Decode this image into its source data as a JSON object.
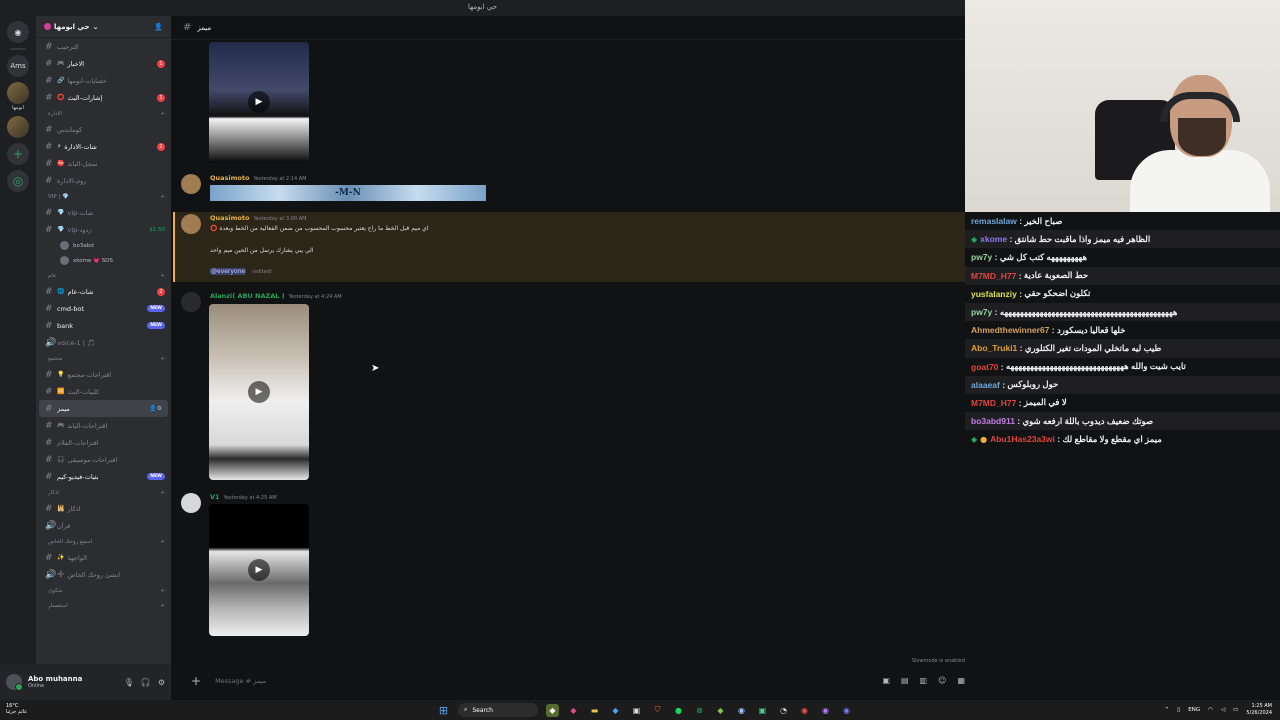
{
  "window": {
    "title": "حي ابومها"
  },
  "servers": [
    {
      "label": "Ams"
    },
    {
      "label": "ابومها"
    }
  ],
  "guild": {
    "name": "حي ابومها"
  },
  "channels": [
    {
      "type": "text",
      "emoji": "",
      "label": "الترحيب",
      "badge": ""
    },
    {
      "type": "text",
      "emoji": "🎮",
      "label": "الاخبار",
      "badge": "1"
    },
    {
      "type": "text",
      "emoji": "🔗",
      "label": "خصايات-ابومها",
      "badge": ""
    },
    {
      "type": "text",
      "emoji": "⭕",
      "label": "إشارات-البث",
      "badge": "1"
    },
    {
      "type": "cat",
      "label": "الادارة"
    },
    {
      "type": "text",
      "emoji": "",
      "label": "كوماندس",
      "badge": ""
    },
    {
      "type": "text",
      "emoji": "⚡",
      "label": "شات-الادارة",
      "badge": "2"
    },
    {
      "type": "text",
      "emoji": "⛔",
      "label": "سجل-الباند",
      "badge": ""
    },
    {
      "type": "text",
      "emoji": "",
      "label": "روم-الادارة",
      "badge": ""
    },
    {
      "type": "cat",
      "label": "VIP | 💎"
    },
    {
      "type": "text",
      "emoji": "💎",
      "label": "vip-شات",
      "badge": ""
    },
    {
      "type": "text",
      "emoji": "💎",
      "label": "vip-ردود",
      "price": "$1.50"
    },
    {
      "type": "voice-user",
      "label": "bo3abd"
    },
    {
      "type": "voice-user",
      "label": "xkome 💗 SOS"
    },
    {
      "type": "cat",
      "label": "عام"
    },
    {
      "type": "text",
      "emoji": "🌐",
      "label": "شات-عام",
      "badge": "2"
    },
    {
      "type": "text",
      "emoji": "",
      "label": "cmd-bot",
      "new": "NEW"
    },
    {
      "type": "text",
      "emoji": "",
      "label": "bank",
      "new": "NEW"
    },
    {
      "type": "voice",
      "emoji": "",
      "label": "voice-1 | 🎵"
    },
    {
      "type": "cat",
      "label": "مجتمع"
    },
    {
      "type": "text",
      "emoji": "💡",
      "label": "اقتراحات-مجتمع",
      "badge": ""
    },
    {
      "type": "text",
      "emoji": "🆚",
      "label": "كليبات-البث",
      "badge": ""
    },
    {
      "type": "text",
      "emoji": "",
      "label": "ميمز",
      "selected": true
    },
    {
      "type": "text",
      "emoji": "🎮",
      "label": "اقتراحات-الباند",
      "badge": ""
    },
    {
      "type": "text",
      "emoji": "",
      "label": "اقتراحات-الفلام",
      "badge": ""
    },
    {
      "type": "text",
      "emoji": "🎧",
      "label": "اقتراحات-موسيقى",
      "badge": ""
    },
    {
      "type": "text",
      "emoji": "",
      "label": "بثيات-فيديو-كيم",
      "new": "NEW"
    },
    {
      "type": "cat",
      "label": "اذكار"
    },
    {
      "type": "text",
      "emoji": "🕌",
      "label": "اذكار",
      "badge": ""
    },
    {
      "type": "voice",
      "emoji": "",
      "label": "قرآن"
    },
    {
      "type": "cat",
      "label": "اسمع روحك الخاص"
    },
    {
      "type": "text",
      "emoji": "✨",
      "label": "الواجهة",
      "badge": ""
    },
    {
      "type": "voice",
      "emoji": "➕",
      "label": "انشئ روحك الخاص"
    },
    {
      "type": "cat",
      "label": "شكوى"
    },
    {
      "type": "cat",
      "label": "استفسار"
    }
  ],
  "user": {
    "name": "Abo muhanna",
    "status": "Online"
  },
  "channel_header": {
    "name": "ميمز"
  },
  "messages": {
    "m1": {
      "author": "Quasimoto",
      "time": "Yesterday at 2:14 AM",
      "banner": "-M-N"
    },
    "m2": {
      "author": "Quasimoto",
      "time": "Yesterday at 3:00 AM",
      "line1": "اي ميم قبل الخط ما راح يعتبر محسوب المحسوب من ضمن الفعالية من الخط وبعده",
      "line2": "الي يبي يشارك يرسل من الحين ميم واحد",
      "mention": "@everyone",
      "edited": "(edited)"
    },
    "m3": {
      "author": "Alanzi( ABU NAZAL )",
      "time": "Yesterday at 4:24 AM"
    },
    "m4": {
      "author": "V1",
      "time": "Yesterday at 4:25 AM"
    }
  },
  "composer": {
    "placeholder": "Message # ميمز"
  },
  "slowmode": "Slowmode is enabled",
  "twitch_chat": [
    {
      "user": "remaslalaw",
      "color": "#6fa8dc",
      "text": "صباح الخير"
    },
    {
      "user": "xkome",
      "color": "#8a7bf0",
      "text": "الظاهر فيه ميمز واذا ماقبت حط شانتق",
      "badge": "green"
    },
    {
      "user": "pw7y",
      "color": "#9ad0a0",
      "text": "هههههههههه كتب كل شي"
    },
    {
      "user": "M7MD_H77",
      "color": "#e0443e",
      "text": "حط الصعوبة عادية"
    },
    {
      "user": "yusfalanziy",
      "color": "#e0e050",
      "text": "تكلون اضحكو حقي"
    },
    {
      "user": "pw7y",
      "color": "#9ad0a0",
      "text": "ههههههههههههههههههههههههههههههههههههههههههههه"
    },
    {
      "user": "Ahmedthewinner67",
      "color": "#d4a35a",
      "text": "خلها قعاليا ديسكورد"
    },
    {
      "user": "Abo_Truki1",
      "color": "#e0a030",
      "text": "طيب ليه ماتخلي المودات تغير الكتلوري"
    },
    {
      "user": "goat70",
      "color": "#e0443e",
      "text": "تايب شيت والله ههههههههههههههههههههههههههههههه"
    },
    {
      "user": "alaaeaf",
      "color": "#6fa8dc",
      "text": "حول روبلوكس"
    },
    {
      "user": "M7MD_H77",
      "color": "#e0443e",
      "text": "لا في الميمز"
    },
    {
      "user": "bo3abd911",
      "color": "#c080e0",
      "text": "صوتك ضعيف ديدوب باللهَ ارفعه شوي"
    },
    {
      "user": "Abu1Has23a3wi",
      "color": "#e0443e",
      "text": "ميمز اي مقطع ولا مقاطع لك",
      "badge": "both"
    }
  ],
  "taskbar": {
    "weather_temp": "16°C",
    "weather_desc": "غائم جزئيا",
    "search": "Search",
    "lang": "ENG",
    "time": "1:25 AM",
    "date": "5/26/2024"
  }
}
